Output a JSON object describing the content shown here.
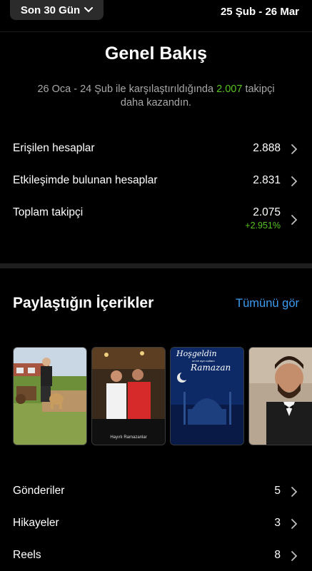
{
  "header": {
    "period_label": "Son 30 Gün",
    "date_range": "25 Şub - 26 Mar"
  },
  "overview": {
    "title": "Genel Bakış",
    "compare_prefix": "26 Oca - 24 Şub ile karşılaştırıldığında",
    "compare_value": "2.007",
    "compare_suffix": "takipçi daha kazandın.",
    "metrics": [
      {
        "label": "Erişilen hesaplar",
        "value": "2.888"
      },
      {
        "label": "Etkileşimde bulunan hesaplar",
        "value": "2.831"
      },
      {
        "label": "Toplam takipçi",
        "value": "2.075",
        "change": "+2.951%"
      }
    ]
  },
  "content": {
    "title": "Paylaştığın İçerikler",
    "see_all": "Tümünü gör",
    "thumbnails": [
      {
        "name": "man-with-dog"
      },
      {
        "name": "two-men-caption",
        "caption": "Hayırlı Ramazanlar"
      },
      {
        "name": "ramadan-mosque",
        "line1": "Hoşgeldin",
        "line2": "on bir ayın sultanı",
        "line3": "Ramazan"
      },
      {
        "name": "man-portrait"
      }
    ]
  },
  "counts": [
    {
      "label": "Gönderiler",
      "value": "5"
    },
    {
      "label": "Hikayeler",
      "value": "3"
    },
    {
      "label": "Reels",
      "value": "8"
    }
  ],
  "colors": {
    "accent_green": "#58c322",
    "link_blue": "#3e9cf0",
    "muted": "#a8a8a8"
  }
}
